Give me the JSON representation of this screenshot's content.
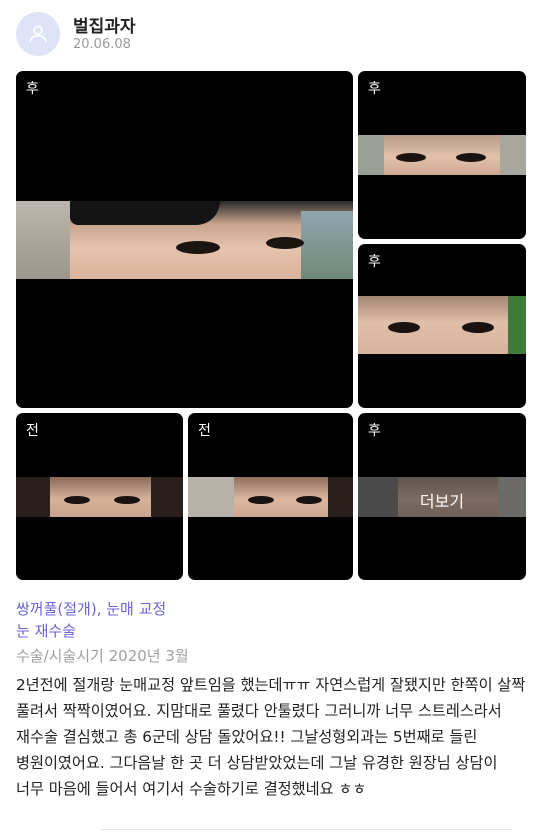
{
  "post": {
    "author": "벌집과자",
    "date": "20.06.08"
  },
  "photos": [
    {
      "tag": "후"
    },
    {
      "tag": "후"
    },
    {
      "tag": "후"
    },
    {
      "tag": "전"
    },
    {
      "tag": "전"
    },
    {
      "tag": "후",
      "overlay": "더보기"
    }
  ],
  "treatments": {
    "line1": "쌍꺼풀(절개), 눈매 교정",
    "line2": "눈 재수술"
  },
  "surgery_info": "수술/시술시기 2020년 3월",
  "review_text": "2년전에 절개랑 눈매교정 앞트임을 했는데ㅠㅠ 자연스럽게 잘됐지만 한쪽이 살짝 풀려서 짝짝이였어요. 지맘대로 풀렸다 안툴렸다 그러니까 너무 스트레스라서 재수술 결심했고 총 6군데 상담 돌았어요!! 그날성형외과는 5번째로 들린 병원이였어요. 그다음날 한 곳 더 상담받았었는데 그날 유경한 원장님 상담이 너무 마음에 들어서 여기서 수술하기로 결정했네요 ㅎㅎ",
  "colors": {
    "accent": "#6c63d6",
    "avatar_bg": "#dfe3f7",
    "photo_bg": "#000000"
  }
}
